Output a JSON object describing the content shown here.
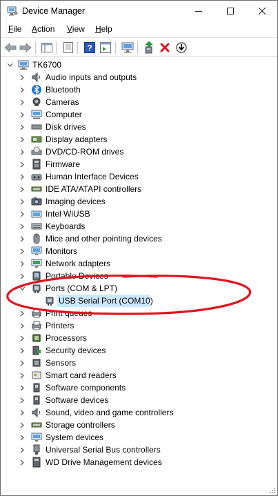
{
  "window": {
    "title": "Device Manager",
    "controls": {
      "minimize": "—",
      "maximize": "☐",
      "close": "✕"
    }
  },
  "menu": [
    {
      "label_underlined": "F",
      "label_rest": "ile"
    },
    {
      "label_underlined": "A",
      "label_rest": "ction"
    },
    {
      "label_underlined": "V",
      "label_rest": "iew"
    },
    {
      "label_underlined": "H",
      "label_rest": "elp"
    }
  ],
  "toolbar": {
    "buttons": [
      "back-icon",
      "forward-icon",
      "show-hide-console-tree-icon",
      "properties-icon",
      "help-icon",
      "action-pane-icon",
      "monitor-icon",
      "update-driver-icon",
      "uninstall-icon",
      "download-driver-icon"
    ]
  },
  "tree": {
    "root": "TK6700",
    "categories": [
      "Audio inputs and outputs",
      "Bluetooth",
      "Cameras",
      "Computer",
      "Disk drives",
      "Display adapters",
      "DVD/CD-ROM drives",
      "Firmware",
      "Human Interface Devices",
      "IDE ATA/ATAPI controllers",
      "Imaging devices",
      "Intel WiUSB",
      "Keyboards",
      "Mice and other pointing devices",
      "Monitors",
      "Network adapters",
      "Portable Devices",
      "Ports (COM & LPT)",
      "Print queues",
      "Printers",
      "Processors",
      "Security devices",
      "Sensors",
      "Smart card readers",
      "Software components",
      "Software devices",
      "Sound, video and game controllers",
      "Storage controllers",
      "System devices",
      "Universal Serial Bus controllers",
      "WD Drive Management devices"
    ],
    "expanded_category": "Ports (COM & LPT)",
    "selected_child": "USB Serial Port (COM10)"
  },
  "colors": {
    "annotation": "#e0141e",
    "selection": "#cce8ff",
    "bluetooth": "#1e73d2",
    "uninstall": "#d6151b"
  }
}
